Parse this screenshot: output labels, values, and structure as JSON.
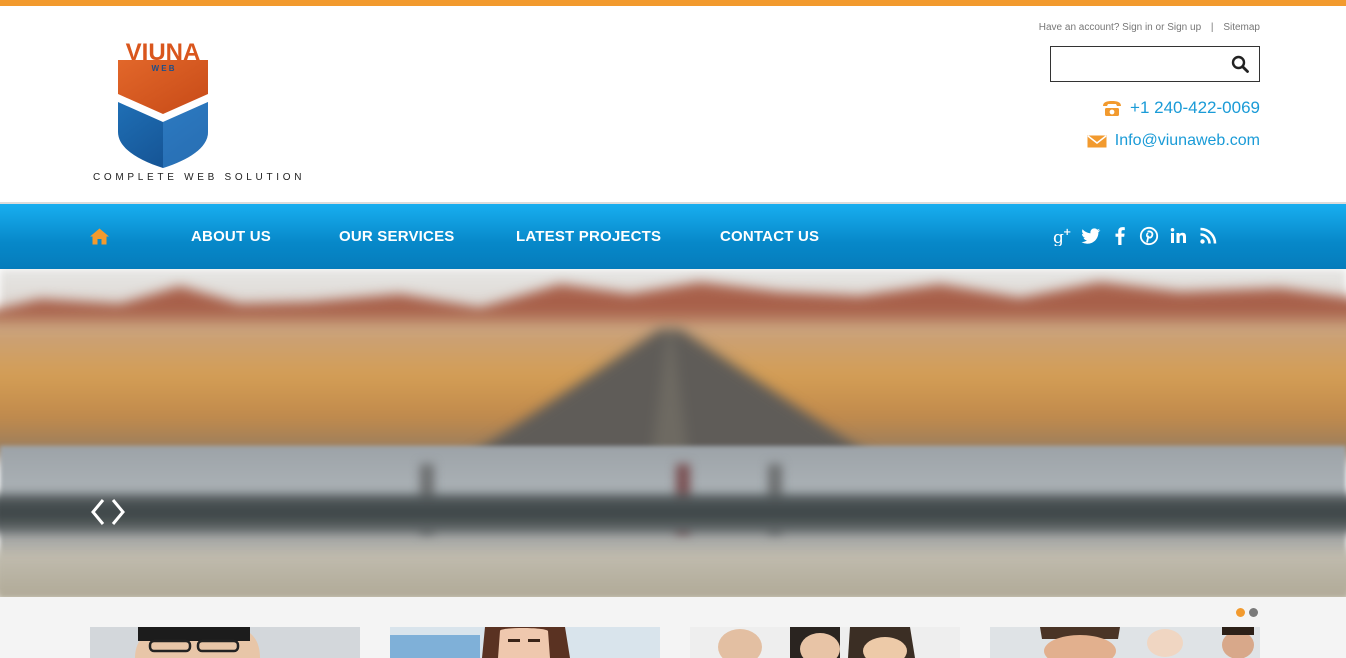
{
  "brand": {
    "name": "VIUNA",
    "sub": "W E B",
    "tagline": "COMPLETE WEB SOLUTION"
  },
  "account": {
    "prompt": "Have an account?",
    "signin": "Sign in",
    "or": "or",
    "signup": "Sign up",
    "separator": "|",
    "sitemap": "Sitemap"
  },
  "search": {
    "placeholder": ""
  },
  "contact": {
    "phone": "+1 240-422-0069",
    "email": "Info@viunaweb.com"
  },
  "nav": {
    "items": [
      {
        "label": "ABOUT US"
      },
      {
        "label": "OUR SERVICES"
      },
      {
        "label": "LATEST PROJECTS"
      },
      {
        "label": "CONTACT US"
      }
    ]
  },
  "social": [
    "google-plus-icon",
    "twitter-icon",
    "facebook-icon",
    "pinterest-icon",
    "linkedin-icon",
    "rss-icon"
  ],
  "slider": {
    "active_slide": 1,
    "slide_count": 2
  },
  "colors": {
    "accent_orange": "#f29a2e",
    "nav_blue": "#0788c9",
    "link_blue": "#1a9bd7",
    "dot_active": "#f29a2e",
    "dot_inactive": "#7a7a7a"
  }
}
